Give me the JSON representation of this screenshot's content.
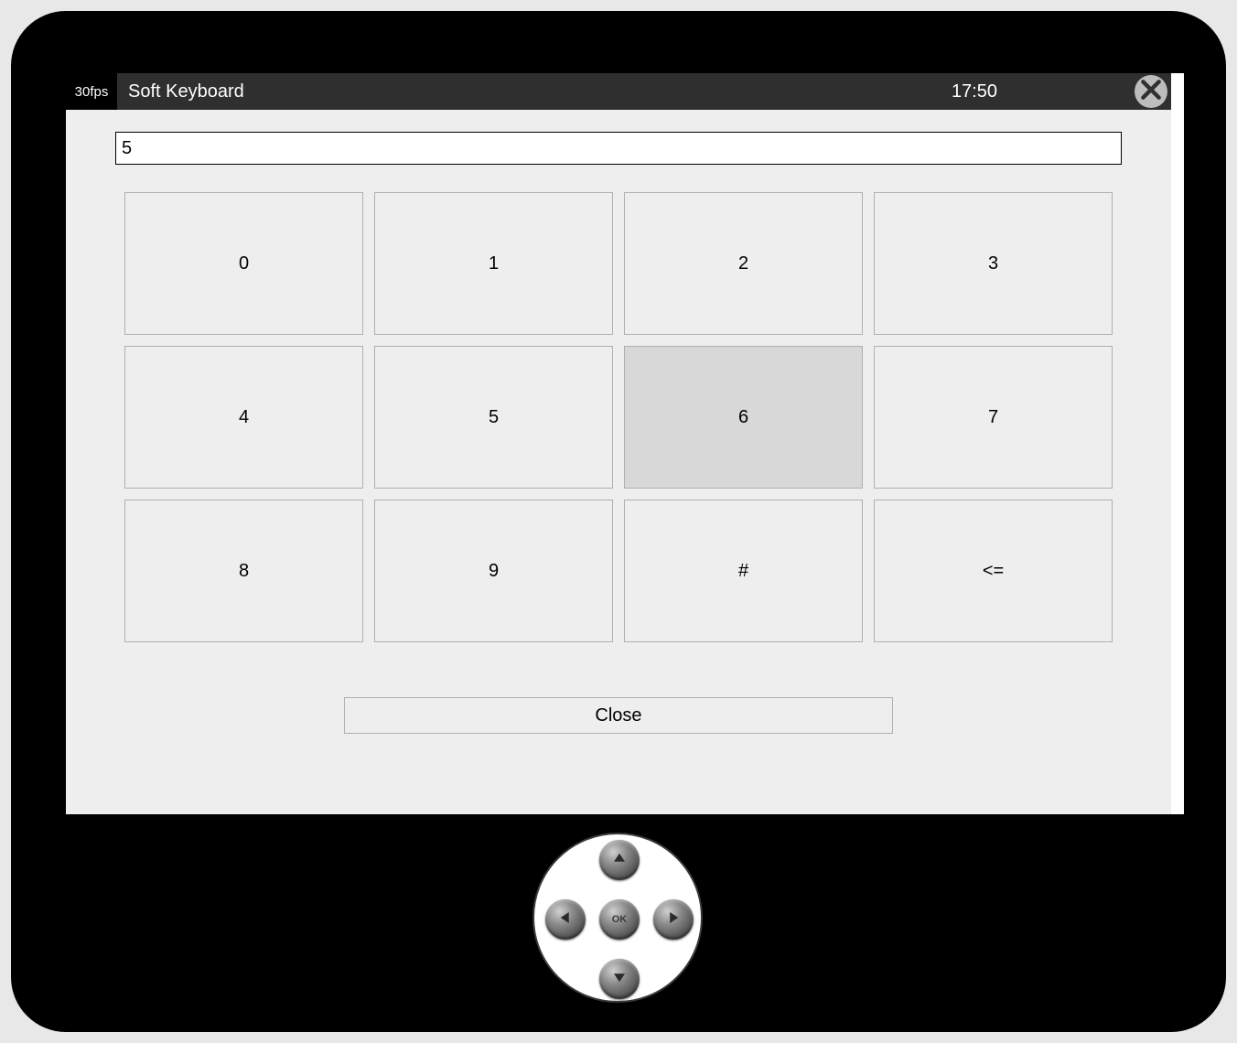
{
  "header": {
    "fps_label": "30fps",
    "title": "Soft Keyboard",
    "clock": "17:50"
  },
  "input": {
    "value": "5"
  },
  "keypad": {
    "keys": [
      "0",
      "1",
      "2",
      "3",
      "4",
      "5",
      "6",
      "7",
      "8",
      "9",
      "#",
      "<="
    ],
    "selected_index": 6
  },
  "close_button_label": "Close",
  "dpad": {
    "ok_label": "OK"
  }
}
